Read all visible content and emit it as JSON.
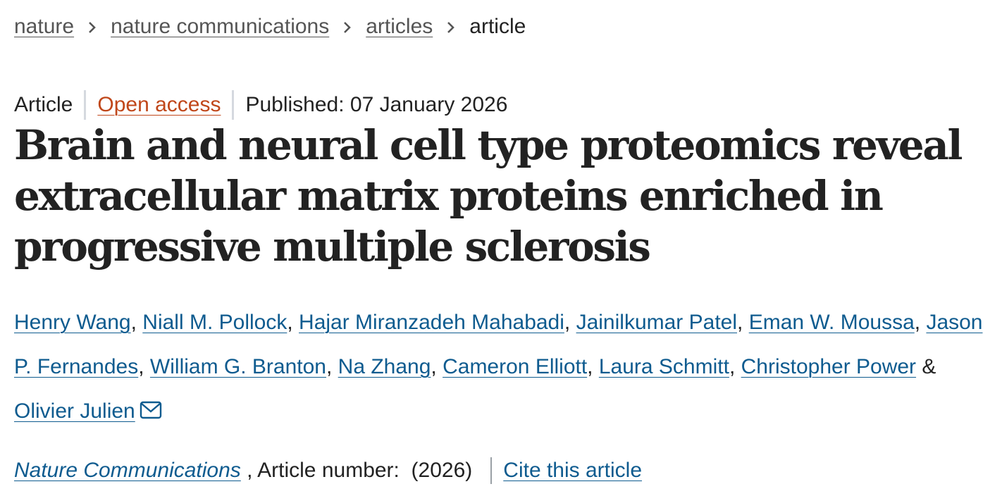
{
  "breadcrumb": {
    "items": [
      "nature",
      "nature communications",
      "articles"
    ],
    "current": "article"
  },
  "meta": {
    "type": "Article",
    "access": "Open access",
    "published": "Published: 07 January 2026"
  },
  "title": "Brain and neural cell type proteomics reveal extracellular matrix proteins enriched in progressive multiple sclerosis",
  "authors": [
    "Henry Wang",
    "Niall M. Pollock",
    "Hajar Miranzadeh Mahabadi",
    "Jainilkumar Patel",
    "Eman W. Moussa",
    "Jason P. Fernandes",
    "William G. Branton",
    "Na Zhang",
    "Cameron Elliott",
    "Laura Schmitt",
    "Christopher Power",
    "Olivier Julien"
  ],
  "author_separator": ", ",
  "author_last_separator": " & ",
  "citation": {
    "journal": "Nature Communications",
    "article_number": " , Article number:  (2026)",
    "cite_label": "Cite this article"
  },
  "icons": {
    "breadcrumb_separator": "chevron-right-icon",
    "corresponding_author": "mail-icon"
  },
  "colors": {
    "link": "#0e5b8f",
    "open_access": "#c0471a",
    "text": "#222222"
  }
}
